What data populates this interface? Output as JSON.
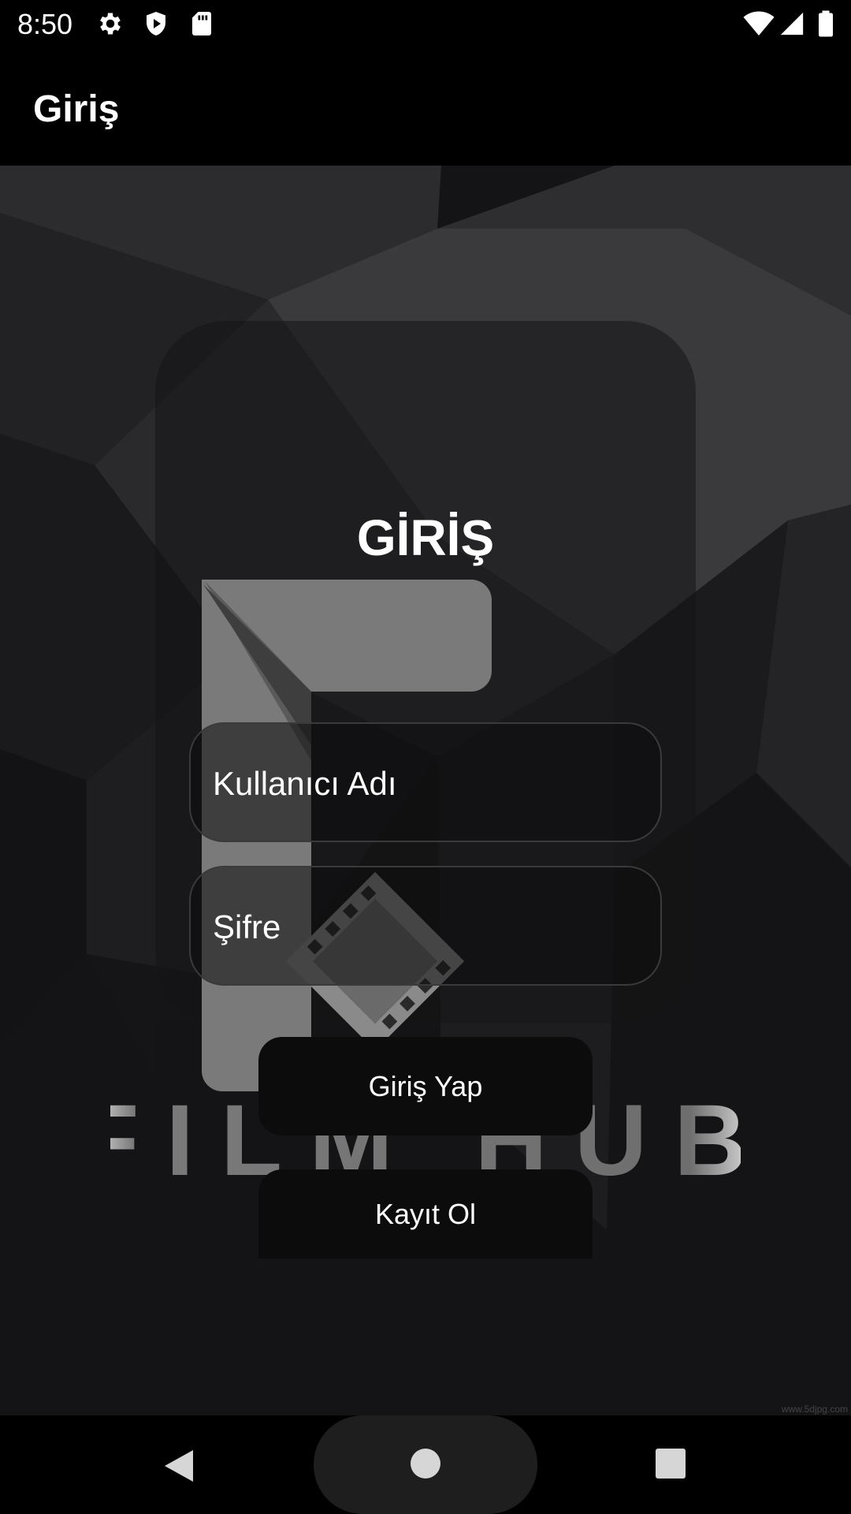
{
  "status_bar": {
    "time": "8:50",
    "left_icons": [
      "gear-icon",
      "shield-play-icon",
      "sd-card-icon"
    ],
    "right_icons": [
      "wifi-icon",
      "signal-icon",
      "battery-icon"
    ]
  },
  "app_bar": {
    "title": "Giriş"
  },
  "card": {
    "heading": "GİRİŞ",
    "logo_text": "FILM HUB",
    "username_field": {
      "label": "Kullanıcı Adı"
    },
    "password_field": {
      "label": "Şifre"
    },
    "login_button": "Giriş Yap",
    "register_button": "Kayıt Ol"
  },
  "watermark": "www.5djpg.com",
  "nav_bar": {
    "icons": [
      "back-icon",
      "home-icon",
      "recents-icon"
    ]
  },
  "colors": {
    "background": "#121214",
    "bars": "#000000",
    "text": "#ffffff",
    "button": "#0c0c0d"
  }
}
